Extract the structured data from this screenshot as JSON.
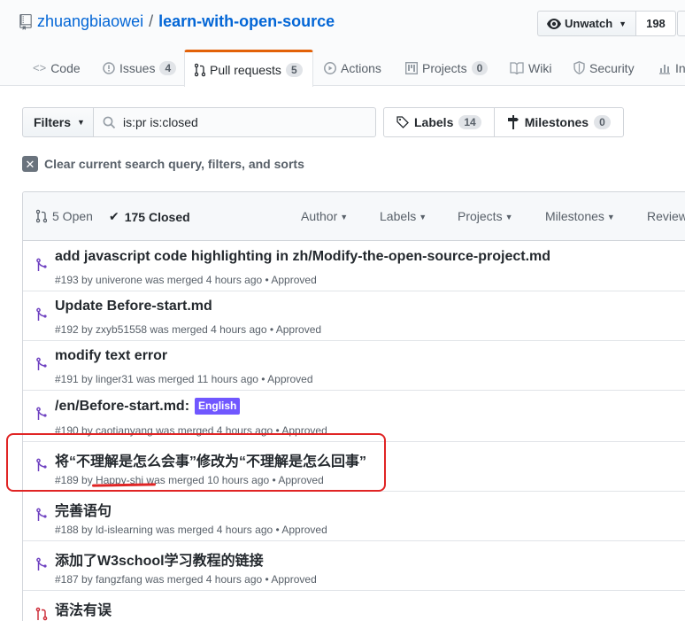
{
  "repo": {
    "owner": "zhuangbiaowei",
    "separator": "/",
    "name": "learn-with-open-source"
  },
  "watch": {
    "label": "Unwatch",
    "count": "198"
  },
  "tabs": [
    {
      "label": "Code",
      "icon": "code-icon"
    },
    {
      "label": "Issues",
      "count": "4",
      "icon": "issue-icon"
    },
    {
      "label": "Pull requests",
      "count": "5",
      "icon": "pull-request-icon",
      "selected": true
    },
    {
      "label": "Actions",
      "icon": "play-icon"
    },
    {
      "label": "Projects",
      "count": "0",
      "icon": "project-icon"
    },
    {
      "label": "Wiki",
      "icon": "book-icon"
    },
    {
      "label": "Security",
      "icon": "shield-icon"
    },
    {
      "label": "In",
      "icon": "graph-icon"
    }
  ],
  "filters": {
    "button_label": "Filters",
    "search_value": "is:pr is:closed"
  },
  "labels_button": {
    "label": "Labels",
    "count": "14"
  },
  "milestones_button": {
    "label": "Milestones",
    "count": "0"
  },
  "clear_text": "Clear current search query, filters, and sorts",
  "header": {
    "open": "5 Open",
    "closed": "175 Closed",
    "author": "Author",
    "labels": "Labels",
    "projects": "Projects",
    "milestones": "Milestones",
    "reviews": "Reviews"
  },
  "pull_requests": [
    {
      "title": "add javascript code highlighting in zh/Modify-the-open-source-project.md",
      "meta_pre": "#193 by ",
      "author": "univerone",
      "meta_post": " was merged 4 hours ago • Approved",
      "status": "merged"
    },
    {
      "title": "Update Before-start.md",
      "meta_pre": "#192 by ",
      "author": "zxyb51558",
      "meta_post": " was merged 4 hours ago • Approved",
      "status": "merged"
    },
    {
      "title": "modify text error",
      "meta_pre": "#191 by ",
      "author": "linger31",
      "meta_post": " was merged 11 hours ago • Approved",
      "status": "merged"
    },
    {
      "title": "/en/Before-start.md:",
      "label": "English",
      "label_color": "#7057ff",
      "meta_pre": "#190 by ",
      "author": "caotianyang",
      "meta_post": " was merged 4 hours ago • Approved",
      "status": "merged"
    },
    {
      "title": "将“不理解是怎么会事”修改为“不理解是怎么回事”",
      "meta_pre": "#189 by ",
      "author": "Happy-shi",
      "meta_post": " was merged 10 hours ago • Approved",
      "status": "merged",
      "highlighted": true
    },
    {
      "title": "完善语句",
      "meta_pre": "#188 by ",
      "author": "ld-islearning",
      "meta_post": " was merged 4 hours ago • Approved",
      "status": "merged"
    },
    {
      "title": "添加了W3school学习教程的链接",
      "meta_pre": "#187 by ",
      "author": "fangzfang",
      "meta_post": " was merged 4 hours ago • Approved",
      "status": "merged"
    },
    {
      "title": "语法有误",
      "status": "closed"
    }
  ],
  "colors": {
    "merged": "#6f42c1",
    "closed": "#cb2431",
    "annotation": "#e02424",
    "link": "#0366d6",
    "tab_accent": "#e36209"
  }
}
